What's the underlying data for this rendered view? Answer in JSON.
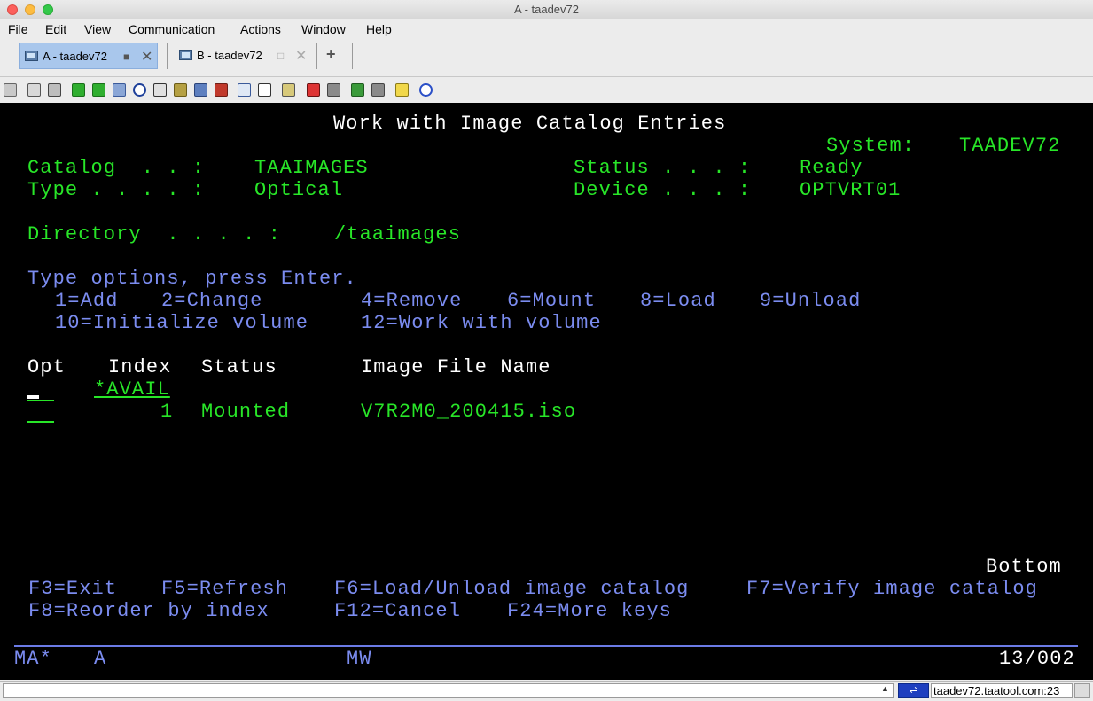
{
  "window": {
    "title": "A - taadev72"
  },
  "menu": [
    "File",
    "Edit",
    "View",
    "Communication",
    "Actions",
    "Window",
    "Help"
  ],
  "tabs": [
    {
      "label": "A - taadev72",
      "close": "✕",
      "square": "■"
    },
    {
      "label": "B - taadev72",
      "close": "✕",
      "square": "□"
    }
  ],
  "new_tab_label": "+",
  "toolbar_icons": [
    "copy-icon",
    "paste-icon",
    "clipboard-icon",
    "send-file-icon",
    "receive-file-icon",
    "print-icon",
    "navigate-icon",
    "macro-icon",
    "keypad-icon",
    "settings-icon",
    "trace-icon",
    "record-icon",
    "display-icon",
    "grid-icon",
    "keyboard-map-icon",
    "play-icon",
    "stop-icon",
    "transfer-icon",
    "log-icon",
    "notes-icon",
    "help-icon"
  ],
  "screen": {
    "title": "Work with Image Catalog Entries",
    "system_label": "System:",
    "system_value": "TAADEV72",
    "catalog_label": "Catalog  . . :",
    "catalog_value": "TAAIMAGES",
    "status_label": "Status . . . :",
    "status_value": "Ready",
    "type_label": "Type . . . . :",
    "type_value": "Optical",
    "device_label": "Device . . . :",
    "device_value": "OPTVRT01",
    "directory_label": "Directory  . . . . :",
    "directory_value": "/taaimages",
    "instructions": "Type options, press Enter.",
    "options_line1": [
      {
        "text": "1=Add",
        "col": 62
      },
      {
        "text": "2=Change",
        "col": 182
      },
      {
        "text": "4=Remove",
        "col": 407
      },
      {
        "text": "6=Mount",
        "col": 572
      },
      {
        "text": "8=Load",
        "col": 722
      },
      {
        "text": "9=Unload",
        "col": 857
      }
    ],
    "options_line2": [
      {
        "text": "10=Initialize volume",
        "col": 62
      },
      {
        "text": "12=Work with volume",
        "col": 407
      }
    ],
    "columns": {
      "opt": "Opt",
      "index": "Index",
      "status": "Status",
      "image_file_name": "Image File Name"
    },
    "rows": [
      {
        "index": "*AVAIL",
        "status": "",
        "file": ""
      },
      {
        "index": "1",
        "status": "Mounted",
        "file": "V7R2M0_200415.iso"
      }
    ],
    "more_indicator": "Bottom",
    "fkeys_line1": [
      {
        "text": "F3=Exit",
        "col": 32
      },
      {
        "text": "F5=Refresh",
        "col": 182
      },
      {
        "text": "F6=Load/Unload image catalog",
        "col": 377
      },
      {
        "text": "F7=Verify image catalog",
        "col": 842
      }
    ],
    "fkeys_line2": [
      {
        "text": "F8=Reorder by index",
        "col": 32
      },
      {
        "text": "F12=Cancel",
        "col": 377
      },
      {
        "text": "F24=More keys",
        "col": 572
      }
    ]
  },
  "oia": {
    "session": "MA*",
    "session_id": "A",
    "mode": "MW",
    "cursor_pos": "13/002"
  },
  "statusbar": {
    "host": "taadev72.taatool.com:23",
    "scroll_arrow": "▲",
    "connection_icon": "⇌"
  },
  "colors": {
    "screen_bg": "#000000",
    "green": "#28e628",
    "blue": "#7b8cf0",
    "white": "#ffffff",
    "tab_active": "#a9c7ec"
  }
}
